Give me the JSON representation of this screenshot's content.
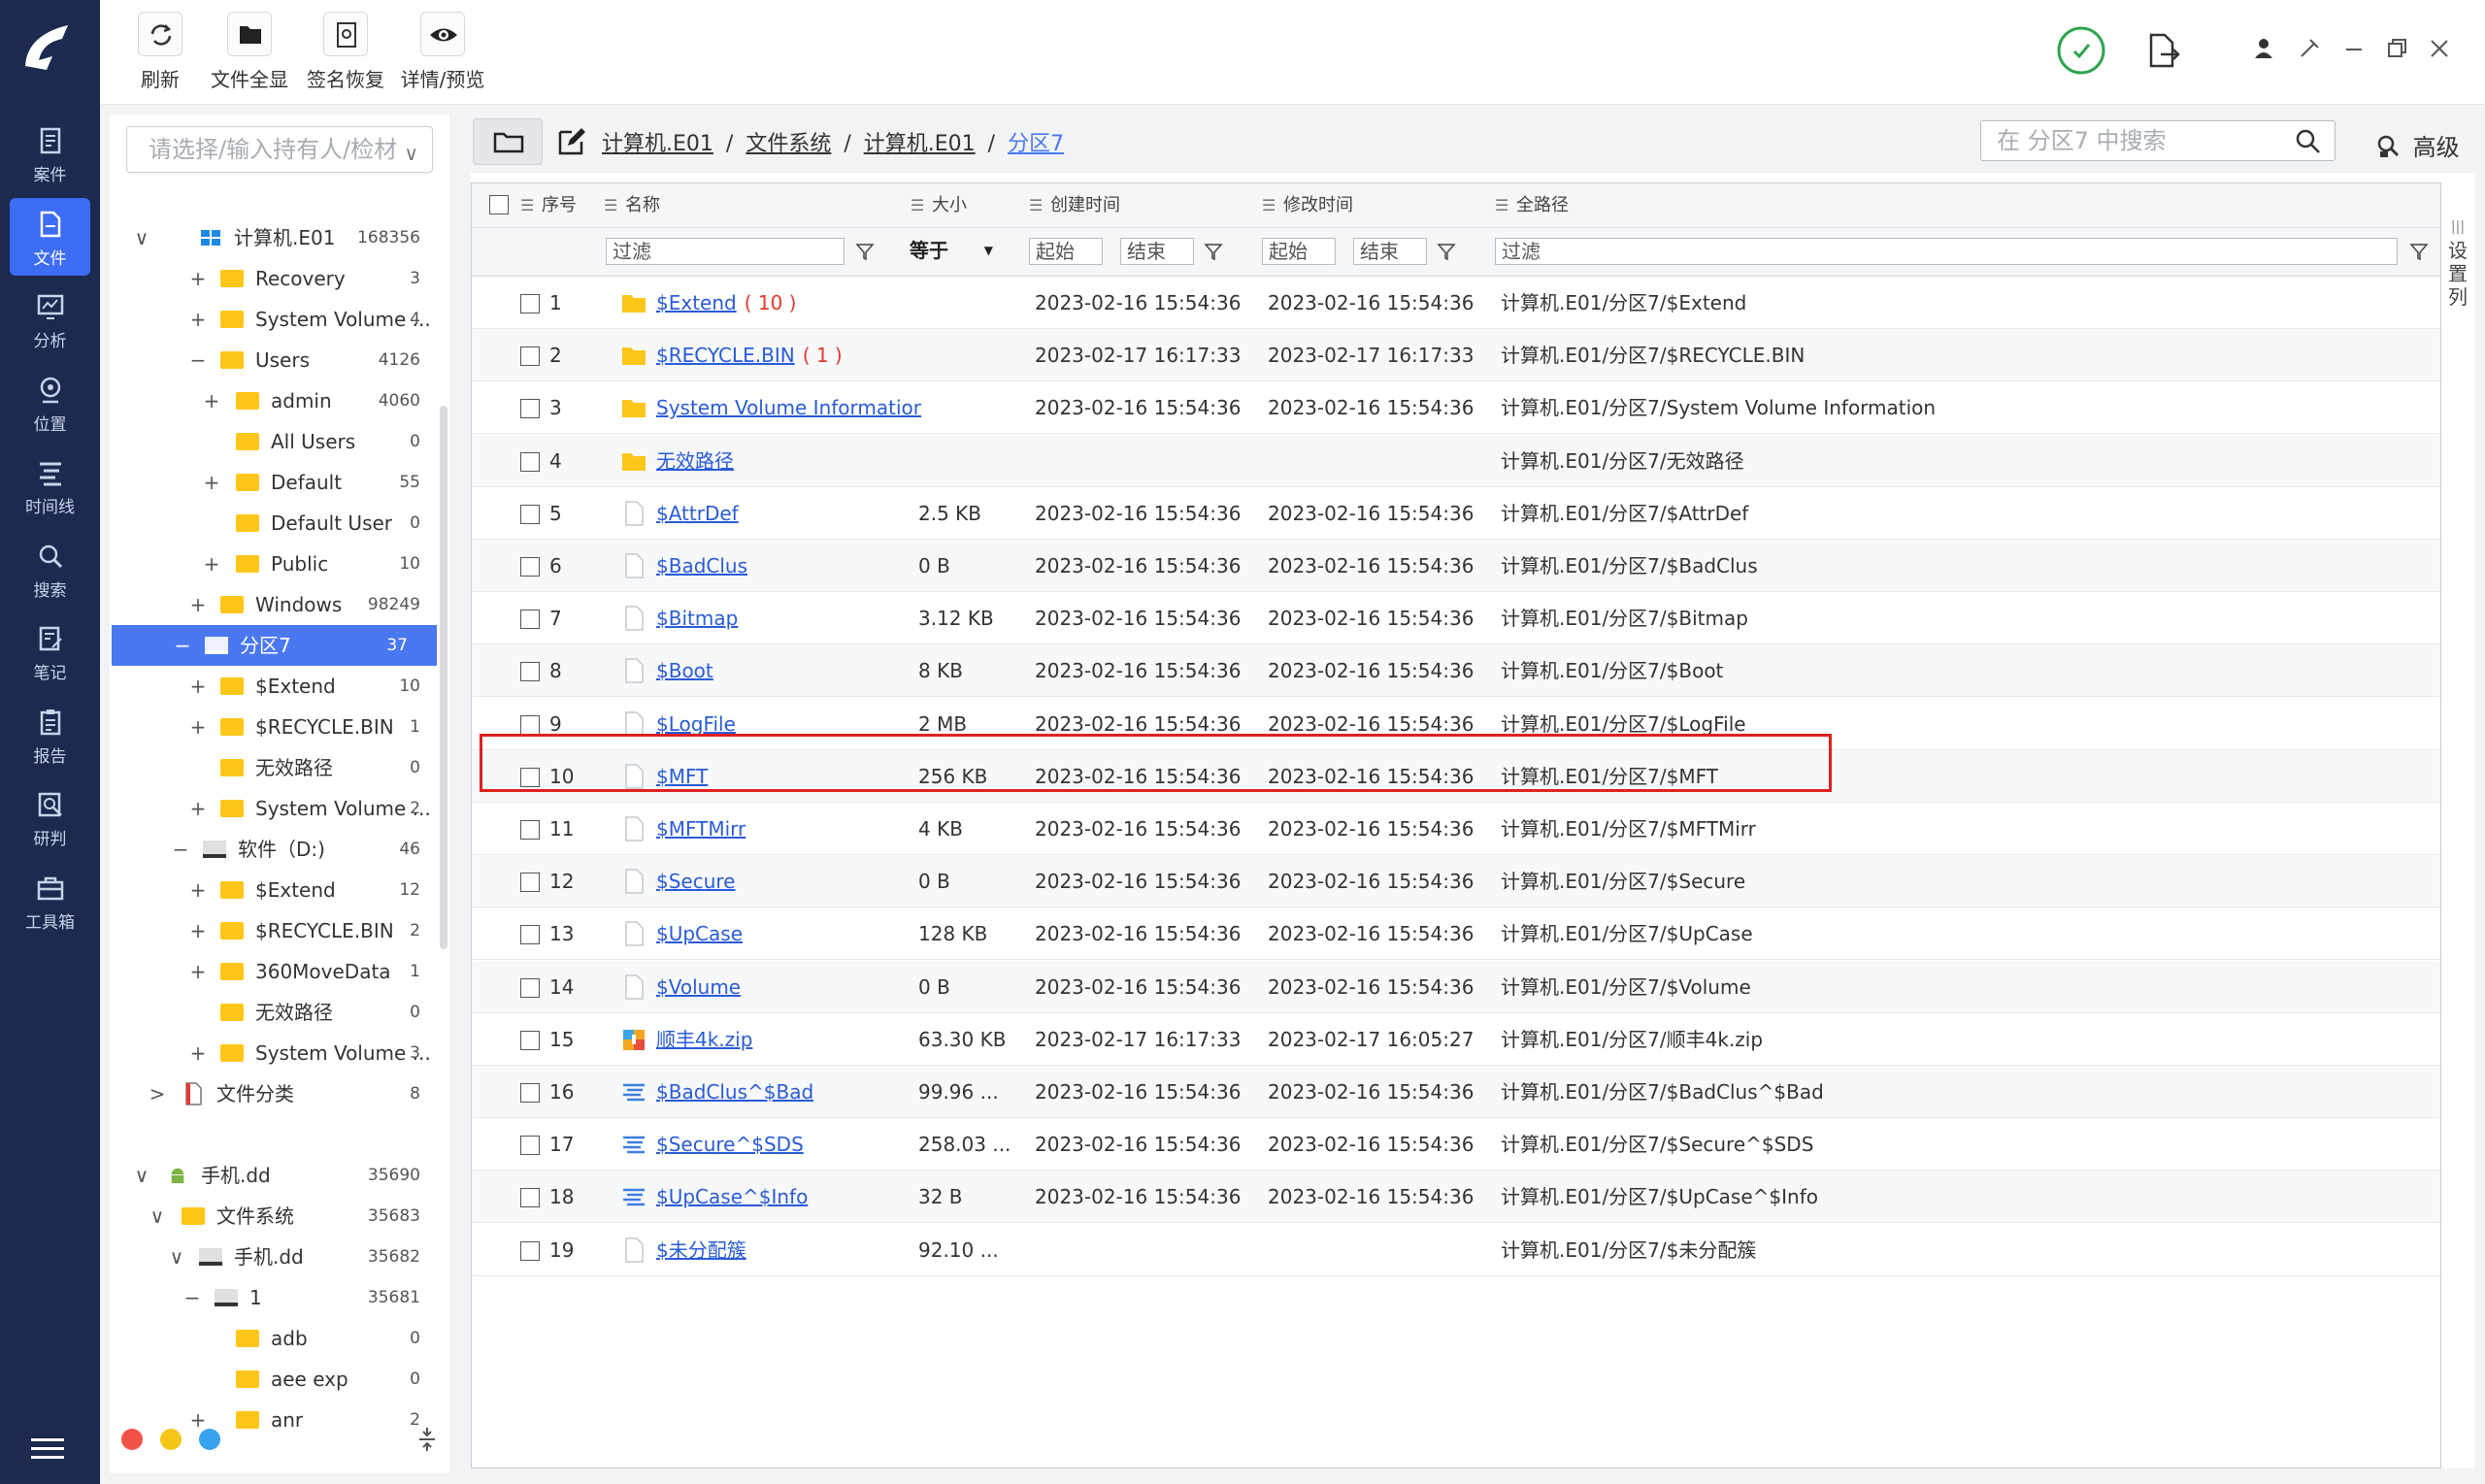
{
  "toolbar": {
    "buttons": [
      {
        "label": "刷新",
        "icon": "refresh-icon"
      },
      {
        "label": "文件全显",
        "icon": "folder-icon"
      },
      {
        "label": "签名恢复",
        "icon": "signature-icon"
      },
      {
        "label": "详情/预览",
        "icon": "eye-icon"
      }
    ]
  },
  "nav": {
    "items": [
      {
        "label": "案件",
        "icon": "case-icon"
      },
      {
        "label": "文件",
        "icon": "file-icon"
      },
      {
        "label": "分析",
        "icon": "analysis-icon"
      },
      {
        "label": "位置",
        "icon": "location-icon"
      },
      {
        "label": "时间线",
        "icon": "timeline-icon"
      },
      {
        "label": "搜索",
        "icon": "search-icon"
      },
      {
        "label": "笔记",
        "icon": "note-icon"
      },
      {
        "label": "报告",
        "icon": "report-icon"
      },
      {
        "label": "研判",
        "icon": "judge-icon"
      },
      {
        "label": "工具箱",
        "icon": "toolbox-icon"
      }
    ],
    "active_index": 1
  },
  "tree": {
    "holder_placeholder": "请选择/输入持有人/检材",
    "rows": [
      {
        "toggle": "∨",
        "icon": "windows",
        "label": "计算机.E01",
        "count": "168356"
      },
      {
        "toggle": "+",
        "icon": "folder",
        "label": "Recovery",
        "count": "3"
      },
      {
        "toggle": "+",
        "icon": "folder",
        "label": "System Volume ...",
        "count": "4"
      },
      {
        "toggle": "−",
        "icon": "folder",
        "label": "Users",
        "count": "4126"
      },
      {
        "toggle": "+",
        "icon": "folder",
        "label": "admin",
        "count": "4060"
      },
      {
        "toggle": "",
        "icon": "folder",
        "label": "All Users",
        "count": "0"
      },
      {
        "toggle": "+",
        "icon": "folder",
        "label": "Default",
        "count": "55"
      },
      {
        "toggle": "",
        "icon": "folder",
        "label": "Default User",
        "count": "0"
      },
      {
        "toggle": "+",
        "icon": "folder",
        "label": "Public",
        "count": "10"
      },
      {
        "toggle": "+",
        "icon": "folder",
        "label": "Windows",
        "count": "98249"
      },
      {
        "toggle": "−",
        "icon": "drive",
        "label": "分区7",
        "count": "37"
      },
      {
        "toggle": "+",
        "icon": "folder",
        "label": "$Extend",
        "count": "10"
      },
      {
        "toggle": "+",
        "icon": "folder",
        "label": "$RECYCLE.BIN",
        "count": "1"
      },
      {
        "toggle": "",
        "icon": "folder",
        "label": "无效路径",
        "count": "0"
      },
      {
        "toggle": "+",
        "icon": "folder",
        "label": "System Volume ...",
        "count": "2"
      },
      {
        "toggle": "−",
        "icon": "drive",
        "label": "软件（D:)",
        "count": "46"
      },
      {
        "toggle": "+",
        "icon": "folder",
        "label": "$Extend",
        "count": "12"
      },
      {
        "toggle": "+",
        "icon": "folder",
        "label": "$RECYCLE.BIN",
        "count": "2"
      },
      {
        "toggle": "+",
        "icon": "folder",
        "label": "360MoveData",
        "count": "1"
      },
      {
        "toggle": "",
        "icon": "folder",
        "label": "无效路径",
        "count": "0"
      },
      {
        "toggle": "+",
        "icon": "folder",
        "label": "System Volume ...",
        "count": "3"
      },
      {
        "toggle": ">",
        "icon": "doc",
        "label": "文件分类",
        "count": "8"
      },
      {
        "toggle": "∨",
        "icon": "android",
        "label": "手机.dd",
        "count": "35690"
      },
      {
        "toggle": "∨",
        "icon": "folder",
        "label": "文件系统",
        "count": "35683"
      },
      {
        "toggle": "∨",
        "icon": "drive",
        "label": "手机.dd",
        "count": "35682"
      },
      {
        "toggle": "−",
        "icon": "drive",
        "label": "1",
        "count": "35681"
      },
      {
        "toggle": "",
        "icon": "folder",
        "label": "adb",
        "count": "0"
      },
      {
        "toggle": "",
        "icon": "folder",
        "label": "aee exp",
        "count": "0"
      },
      {
        "toggle": "+",
        "icon": "folder",
        "label": "anr",
        "count": "2"
      }
    ],
    "selected_index": 10
  },
  "breadcrumb": {
    "items": [
      "计算机.E01",
      "文件系统",
      "计算机.E01",
      "分区7"
    ],
    "separator": "/"
  },
  "search": {
    "placeholder": "在 分区7 中搜索",
    "advanced_label": "高级"
  },
  "table": {
    "headers": {
      "index": "序号",
      "name": "名称",
      "size": "大小",
      "created": "创建时间",
      "modified": "修改时间",
      "path": "全路径"
    },
    "filter": {
      "name": "过滤",
      "size_op": "等于",
      "start": "起始",
      "end": "结束",
      "path": "过滤"
    },
    "side_tab": "设置列",
    "rows": [
      {
        "n": "1",
        "icon": "folder",
        "name": "$Extend",
        "extra": "( 10 )",
        "size": "",
        "created": "2023-02-16 15:54:36",
        "modified": "2023-02-16 15:54:36",
        "path": "计算机.E01/分区7/$Extend"
      },
      {
        "n": "2",
        "icon": "folder",
        "name": "$RECYCLE.BIN",
        "extra": "( 1 )",
        "size": "",
        "created": "2023-02-17 16:17:33",
        "modified": "2023-02-17 16:17:33",
        "path": "计算机.E01/分区7/$RECYCLE.BIN"
      },
      {
        "n": "3",
        "icon": "folder",
        "name": "System Volume Informatior",
        "extra": "",
        "size": "",
        "created": "2023-02-16 15:54:36",
        "modified": "2023-02-16 15:54:36",
        "path": "计算机.E01/分区7/System Volume Information"
      },
      {
        "n": "4",
        "icon": "folder",
        "name": "无效路径",
        "extra": "",
        "size": "",
        "created": "",
        "modified": "",
        "path": "计算机.E01/分区7/无效路径"
      },
      {
        "n": "5",
        "icon": "file",
        "name": "$AttrDef",
        "extra": "",
        "size": "2.5 KB",
        "created": "2023-02-16 15:54:36",
        "modified": "2023-02-16 15:54:36",
        "path": "计算机.E01/分区7/$AttrDef"
      },
      {
        "n": "6",
        "icon": "file",
        "name": "$BadClus",
        "extra": "",
        "size": "0 B",
        "created": "2023-02-16 15:54:36",
        "modified": "2023-02-16 15:54:36",
        "path": "计算机.E01/分区7/$BadClus"
      },
      {
        "n": "7",
        "icon": "file",
        "name": "$Bitmap",
        "extra": "",
        "size": "3.12 KB",
        "created": "2023-02-16 15:54:36",
        "modified": "2023-02-16 15:54:36",
        "path": "计算机.E01/分区7/$Bitmap"
      },
      {
        "n": "8",
        "icon": "file",
        "name": "$Boot",
        "extra": "",
        "size": "8 KB",
        "created": "2023-02-16 15:54:36",
        "modified": "2023-02-16 15:54:36",
        "path": "计算机.E01/分区7/$Boot"
      },
      {
        "n": "9",
        "icon": "file",
        "name": "$LogFile",
        "extra": "",
        "size": "2 MB",
        "created": "2023-02-16 15:54:36",
        "modified": "2023-02-16 15:54:36",
        "path": "计算机.E01/分区7/$LogFile"
      },
      {
        "n": "10",
        "icon": "file",
        "name": "$MFT",
        "extra": "",
        "size": "256 KB",
        "created": "2023-02-16 15:54:36",
        "modified": "2023-02-16 15:54:36",
        "path": "计算机.E01/分区7/$MFT"
      },
      {
        "n": "11",
        "icon": "file",
        "name": "$MFTMirr",
        "extra": "",
        "size": "4 KB",
        "created": "2023-02-16 15:54:36",
        "modified": "2023-02-16 15:54:36",
        "path": "计算机.E01/分区7/$MFTMirr"
      },
      {
        "n": "12",
        "icon": "file",
        "name": "$Secure",
        "extra": "",
        "size": "0 B",
        "created": "2023-02-16 15:54:36",
        "modified": "2023-02-16 15:54:36",
        "path": "计算机.E01/分区7/$Secure"
      },
      {
        "n": "13",
        "icon": "file",
        "name": "$UpCase",
        "extra": "",
        "size": "128 KB",
        "created": "2023-02-16 15:54:36",
        "modified": "2023-02-16 15:54:36",
        "path": "计算机.E01/分区7/$UpCase"
      },
      {
        "n": "14",
        "icon": "file",
        "name": "$Volume",
        "extra": "",
        "size": "0 B",
        "created": "2023-02-16 15:54:36",
        "modified": "2023-02-16 15:54:36",
        "path": "计算机.E01/分区7/$Volume"
      },
      {
        "n": "15",
        "icon": "zip",
        "name": "顺丰4k.zip",
        "extra": "",
        "size": "63.30 KB",
        "created": "2023-02-17 16:17:33",
        "modified": "2023-02-17 16:05:27",
        "path": "计算机.E01/分区7/顺丰4k.zip"
      },
      {
        "n": "16",
        "icon": "stream",
        "name": "$BadClus^$Bad",
        "extra": "",
        "size": "99.96 ...",
        "created": "2023-02-16 15:54:36",
        "modified": "2023-02-16 15:54:36",
        "path": "计算机.E01/分区7/$BadClus^$Bad"
      },
      {
        "n": "17",
        "icon": "stream",
        "name": "$Secure^$SDS",
        "extra": "",
        "size": "258.03 ...",
        "created": "2023-02-16 15:54:36",
        "modified": "2023-02-16 15:54:36",
        "path": "计算机.E01/分区7/$Secure^$SDS"
      },
      {
        "n": "18",
        "icon": "stream",
        "name": "$UpCase^$Info",
        "extra": "",
        "size": "32 B",
        "created": "2023-02-16 15:54:36",
        "modified": "2023-02-16 15:54:36",
        "path": "计算机.E01/分区7/$UpCase^$Info"
      },
      {
        "n": "19",
        "icon": "file",
        "name": "$未分配簇",
        "extra": "",
        "size": "92.10 ...",
        "created": "",
        "modified": "",
        "path": "计算机.E01/分区7/$未分配簇"
      }
    ],
    "highlighted_row": 15
  },
  "colors": {
    "nav_bg": "#1b2a4e",
    "accent": "#4a78f0",
    "highlight_border": "#e02020",
    "folder": "#ffc61a"
  }
}
